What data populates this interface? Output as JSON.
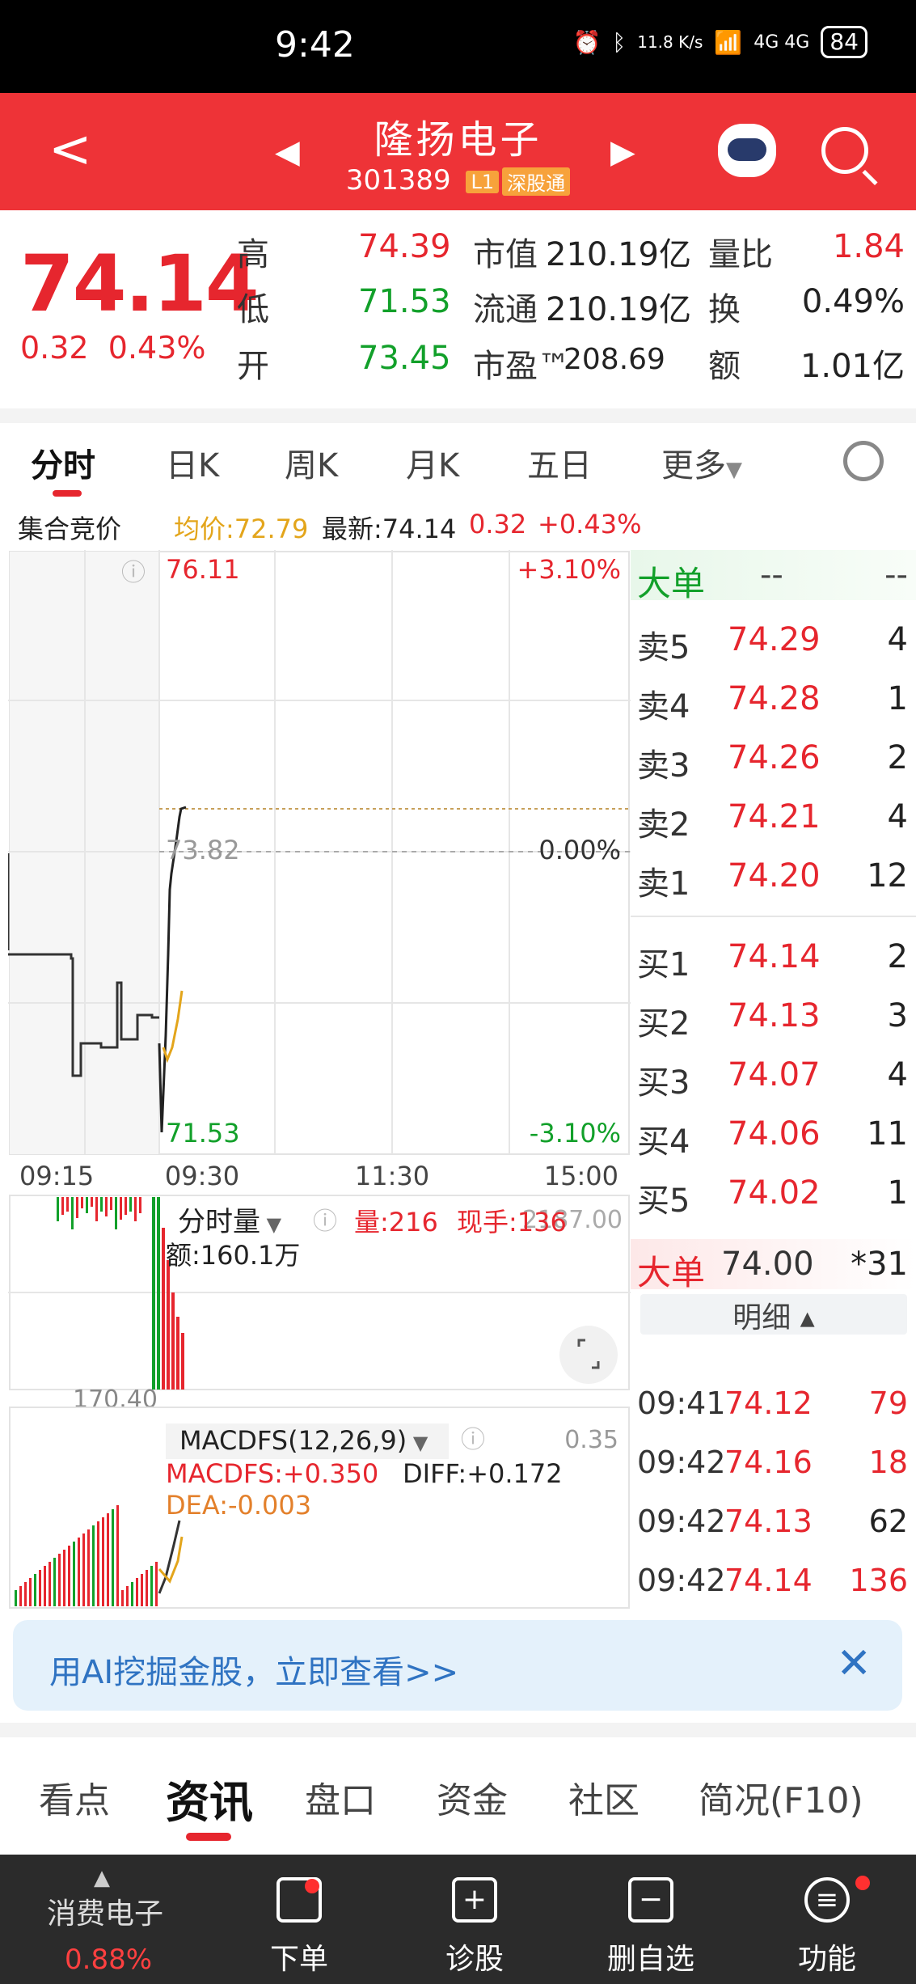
{
  "status_bar": {
    "time": "9:42",
    "net_speed": "11.8 K/s",
    "signal": "4G 4G",
    "battery": "84"
  },
  "header": {
    "stock_name": "隆扬电子",
    "stock_code": "301389",
    "level_tag": "L1",
    "connect_tag": "深股通"
  },
  "quote": {
    "price": "74.14",
    "change": "0.32",
    "change_pct": "0.43%",
    "stats": [
      {
        "label": "高",
        "value": "74.39"
      },
      {
        "label": "低",
        "value": "71.53"
      },
      {
        "label": "开",
        "value": "73.45"
      },
      {
        "label": "市值",
        "value": "210.19亿"
      },
      {
        "label": "流通",
        "value": "210.19亿"
      },
      {
        "label": "市盈™",
        "value": "208.69"
      },
      {
        "label": "量比",
        "value": "1.84"
      },
      {
        "label": "换",
        "value": "0.49%"
      },
      {
        "label": "额",
        "value": "1.01亿"
      }
    ]
  },
  "chart_tabs": [
    "分时",
    "日K",
    "周K",
    "月K",
    "五日",
    "更多"
  ],
  "info_line": {
    "auction": "集合竞价",
    "avg": "均价:72.79",
    "latest": "最新:74.14",
    "chg": "0.32",
    "pct": "+0.43%"
  },
  "chart": {
    "top_price": "76.11",
    "top_pct": "+3.10%",
    "mid_price": "73.82",
    "mid_pct": "0.00%",
    "low_price": "71.53",
    "low_pct": "-3.10%",
    "times": [
      "09:15",
      "09:30",
      "11:30",
      "15:00"
    ],
    "volume_label": "分时量",
    "volume_info": "量:216",
    "hand_info": "现手:136",
    "amount": "额:160.1万",
    "vol_max": "2187.00",
    "vol_mid": "170.40",
    "macd_label": "MACDFS(12,26,9)",
    "macd_value": "MACDFS:+0.350",
    "diff_value": "DIFF:+0.172",
    "dea_value": "DEA:-0.003",
    "macd_max": "0.35"
  },
  "chart_data": {
    "type": "line",
    "x": [
      "09:15",
      "09:30",
      "11:30",
      "15:00"
    ],
    "ylim": [
      71.53,
      76.11
    ],
    "prev_close": 73.82,
    "series": [
      {
        "name": "均价",
        "values": [
          72.79
        ]
      }
    ]
  },
  "order_book": {
    "header": {
      "title": "大单",
      "d1": "--",
      "d2": "--"
    },
    "asks": [
      {
        "label": "卖5",
        "price": "74.29",
        "qty": "4"
      },
      {
        "label": "卖4",
        "price": "74.28",
        "qty": "1"
      },
      {
        "label": "卖3",
        "price": "74.26",
        "qty": "2"
      },
      {
        "label": "卖2",
        "price": "74.21",
        "qty": "4"
      },
      {
        "label": "卖1",
        "price": "74.20",
        "qty": "12"
      }
    ],
    "bids": [
      {
        "label": "买1",
        "price": "74.14",
        "qty": "2"
      },
      {
        "label": "买2",
        "price": "74.13",
        "qty": "3"
      },
      {
        "label": "买3",
        "price": "74.07",
        "qty": "4"
      },
      {
        "label": "买4",
        "price": "74.06",
        "qty": "11"
      },
      {
        "label": "买5",
        "price": "74.02",
        "qty": "1"
      }
    ],
    "big_order": {
      "title": "大单",
      "price": "74.00",
      "qty": "*31"
    },
    "detail_label": "明细 ▴",
    "ticks": [
      {
        "time": "09:41",
        "price": "74.12",
        "vol": "79"
      },
      {
        "time": "09:42",
        "price": "74.16",
        "vol": "18"
      },
      {
        "time": "09:42",
        "price": "74.13",
        "vol": "62"
      },
      {
        "time": "09:42",
        "price": "74.14",
        "vol": "136"
      }
    ]
  },
  "banner": {
    "text": "用AI挖掘金股，立即查看>>",
    "close": "✕"
  },
  "content_tabs": [
    "看点",
    "资讯",
    "盘口",
    "资金",
    "社区",
    "简况(F10)"
  ],
  "bottom_bar": {
    "sector_name": "消费电子",
    "sector_pct": "0.88%",
    "items": [
      "下单",
      "诊股",
      "删自选",
      "功能"
    ]
  },
  "colors": {
    "up": "#e6262e",
    "down": "#12a02a",
    "header": "#ee3337",
    "avg": "#e3a51b"
  }
}
